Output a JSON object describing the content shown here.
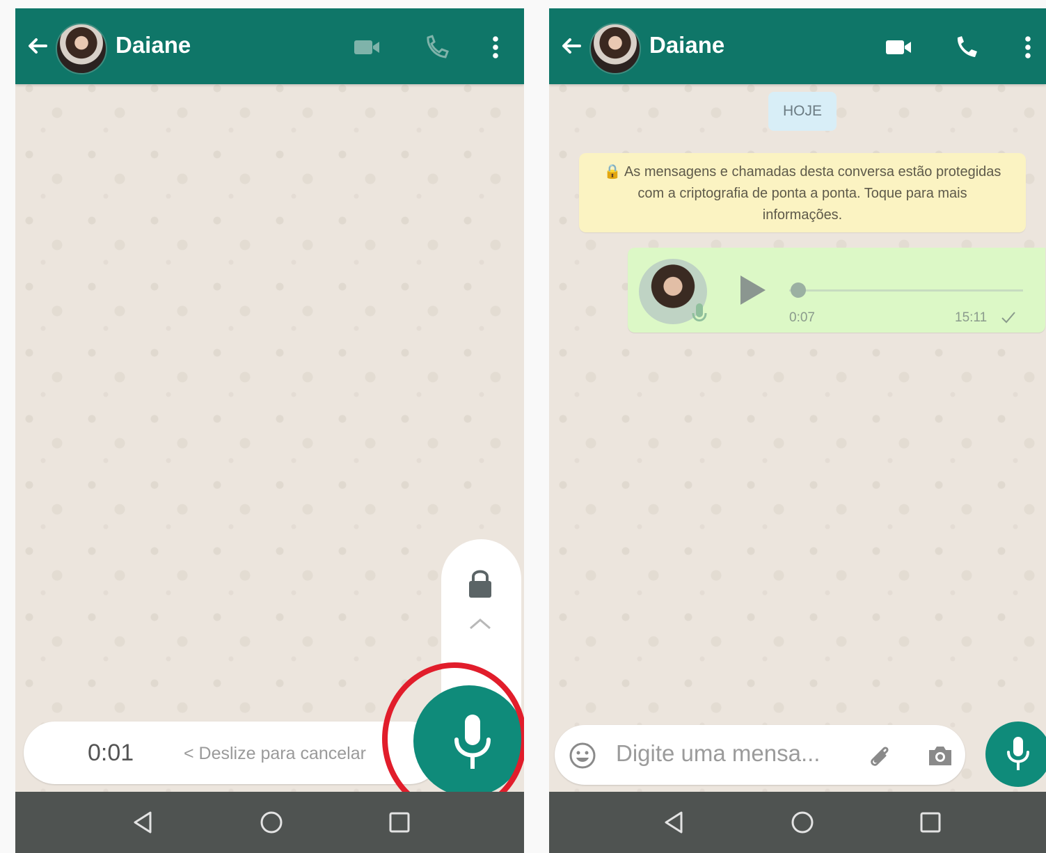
{
  "colors": {
    "appbar": "#0f7668",
    "accent": "#0f8b7a",
    "chat_background": "#ece5dd",
    "navbar": "#4f5351",
    "highlight_circle": "#e11d2b",
    "outgoing_bubble": "#dcf8c6",
    "encryption_notice": "#fbf3c2"
  },
  "left_screen": {
    "header": {
      "contact_name": "Daiane",
      "icons": [
        "back-arrow-icon",
        "avatar",
        "video-call-icon",
        "voice-call-icon",
        "more-options-icon"
      ]
    },
    "recording": {
      "time": "0:01",
      "slide_hint": "< Deslize para cancelar",
      "lock_icon": "lock-icon",
      "swipe_up_icon": "chevron-up-icon",
      "mic_icon": "microphone-icon"
    },
    "navbar": [
      "back-nav-icon",
      "home-nav-icon",
      "recents-nav-icon"
    ]
  },
  "right_screen": {
    "header": {
      "contact_name": "Daiane",
      "icons": [
        "back-arrow-icon",
        "avatar",
        "video-call-icon",
        "voice-call-icon",
        "more-options-icon"
      ]
    },
    "date_chip": "HOJE",
    "encryption_notice": "🔒 As mensagens e chamadas desta conversa estão protegidas com a criptografia de ponta a ponta. Toque para mais informações.",
    "voice_message": {
      "duration": "0:07",
      "time": "15:11",
      "progress": 0.0,
      "status_icon": "single-check-icon"
    },
    "composer": {
      "placeholder": "Digite uma mensa...",
      "icons": [
        "emoji-icon",
        "attach-icon",
        "camera-icon",
        "microphone-icon"
      ]
    },
    "navbar": [
      "back-nav-icon",
      "home-nav-icon",
      "recents-nav-icon"
    ]
  }
}
